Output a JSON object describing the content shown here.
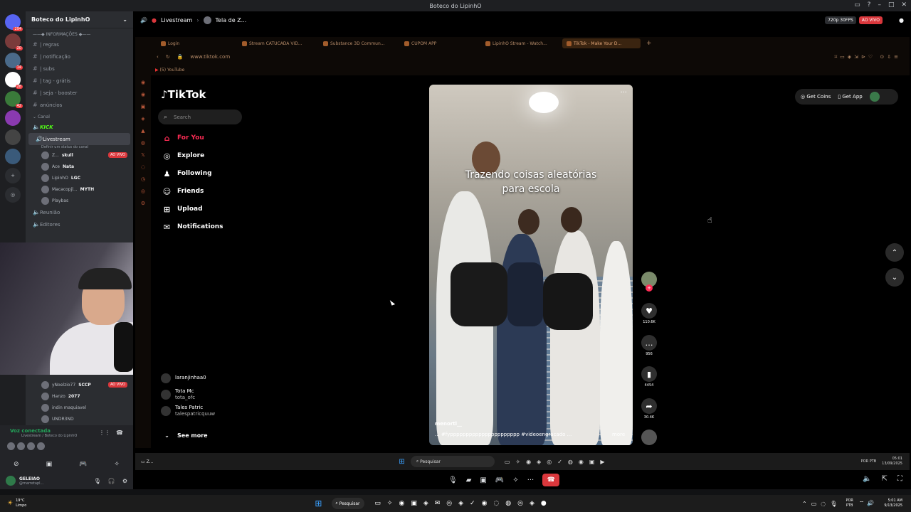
{
  "window_title": "Boteco do LipinhO",
  "rail": {
    "items": [
      {
        "label": "",
        "badge": "294"
      },
      {
        "label": "",
        "badge": "20"
      },
      {
        "label": "",
        "badge": "14"
      },
      {
        "label": "",
        "badge": "28"
      },
      {
        "label": "",
        "badge": "42"
      },
      {
        "label": "",
        "badge": ""
      },
      {
        "label": "",
        "badge": ""
      },
      {
        "label": "",
        "badge": ""
      }
    ]
  },
  "channels": {
    "server_name": "Boteco do LipinhO",
    "category_info": "INFORMAÇÕES",
    "items": [
      {
        "icon": "#",
        "label": "| regras"
      },
      {
        "icon": "#",
        "label": "| notificação"
      },
      {
        "icon": "#",
        "label": "| subs"
      },
      {
        "icon": "#",
        "label": "| tag - grátis"
      },
      {
        "icon": "#",
        "label": "| seja - booster"
      },
      {
        "icon": "#",
        "label": "anúncios"
      }
    ],
    "category_canal": "Canal",
    "kick_label": "KICK",
    "livestream_label": "Livestream",
    "livestream_status": "Definir um status do canal",
    "voice_users": [
      {
        "name": "Z...",
        "tag": "skull",
        "live": "AO VIVO"
      },
      {
        "name": "Ace",
        "tag": "Nata",
        "live": ""
      },
      {
        "name": "LipinhO",
        "tag": "LGC",
        "live": ""
      },
      {
        "name": "Macacopjl...",
        "tag": "MYTH",
        "live": ""
      },
      {
        "name": "Playbas",
        "tag": "",
        "live": ""
      }
    ],
    "reuniao": "Reunião",
    "editores": "Editores",
    "lower_users": [
      {
        "name": "yNoelzio77",
        "tag": "SCCP",
        "live": "AO VIVO"
      },
      {
        "name": "Hanzo",
        "tag": "2077",
        "live": ""
      },
      {
        "name": "indin maquiavel",
        "tag": "",
        "live": ""
      },
      {
        "name": "UNDR3ND",
        "tag": "",
        "live": ""
      }
    ]
  },
  "voice_panel": {
    "status": "Voz conectada",
    "location": "Livestream / Boteco do LipinhO"
  },
  "user_panel": {
    "name": "GELEIAO",
    "handle": "@marretapl..."
  },
  "stream_header": {
    "channel": "Livestream",
    "screen": "Tela de Z...",
    "quality": "720p 30FPS",
    "live": "AO VIVO"
  },
  "browser": {
    "tabs": [
      {
        "label": "Login",
        "active": false
      },
      {
        "label": "Stream CATUCADA VID...",
        "active": false
      },
      {
        "label": "Substance 3D Commun...",
        "active": false
      },
      {
        "label": "CUPOM APP",
        "active": false
      },
      {
        "label": "LipinhO Stream - Watch...",
        "active": false
      },
      {
        "label": "TikTok - Make Your D...",
        "active": true
      }
    ],
    "url": "www.tiktok.com",
    "bookmark": "(5) YouTube"
  },
  "tiktok": {
    "logo": "TikTok",
    "search_placeholder": "Search",
    "nav": [
      {
        "icon": "home-icon",
        "glyph": "⌂",
        "label": "For You",
        "active": true
      },
      {
        "icon": "compass-icon",
        "glyph": "◎",
        "label": "Explore",
        "active": false
      },
      {
        "icon": "following-icon",
        "glyph": "♟",
        "label": "Following",
        "active": false
      },
      {
        "icon": "friends-icon",
        "glyph": "☺",
        "label": "Friends",
        "active": false
      },
      {
        "icon": "upload-icon",
        "glyph": "⊞",
        "label": "Upload",
        "active": false
      },
      {
        "icon": "bell-icon",
        "glyph": "✉",
        "label": "Notifications",
        "active": false
      }
    ],
    "following_list": [
      {
        "name": "laranjinhaa0",
        "handle": ""
      },
      {
        "name": "Tota Mc",
        "handle": "tota_ofc"
      },
      {
        "name": "Tales Patric",
        "handle": "talespatricquuw"
      }
    ],
    "see_more": "See more",
    "get_coins": "Get Coins",
    "get_app": "Get App",
    "video": {
      "caption_line1": "Trazendo coisas aleatórias",
      "caption_line2": "para escola",
      "author": "menortl__",
      "tags": "... #fypppppppppppppppppppppp #videoengracado ...",
      "more": "more",
      "likes": "110.6K",
      "comments": "956",
      "saves": "4454",
      "shares": "30.4K"
    }
  },
  "inner_taskbar": {
    "app": "Z...",
    "search": "Pesquisar",
    "lang": "POR PTB",
    "time": "05:01",
    "date": "13/09/2025"
  },
  "taskbar": {
    "weather_temp": "19°C",
    "weather_desc": "Limpo",
    "search": "Pesquisar",
    "lang_top": "POR",
    "lang_bottom": "PTB",
    "time": "5:01 AM",
    "date": "9/13/2025"
  },
  "colors": {
    "discord_bg": "#2b2d31",
    "tiktok_red": "#fe2c55",
    "live_red": "#da373c",
    "browser_accent": "#b88d6a"
  }
}
